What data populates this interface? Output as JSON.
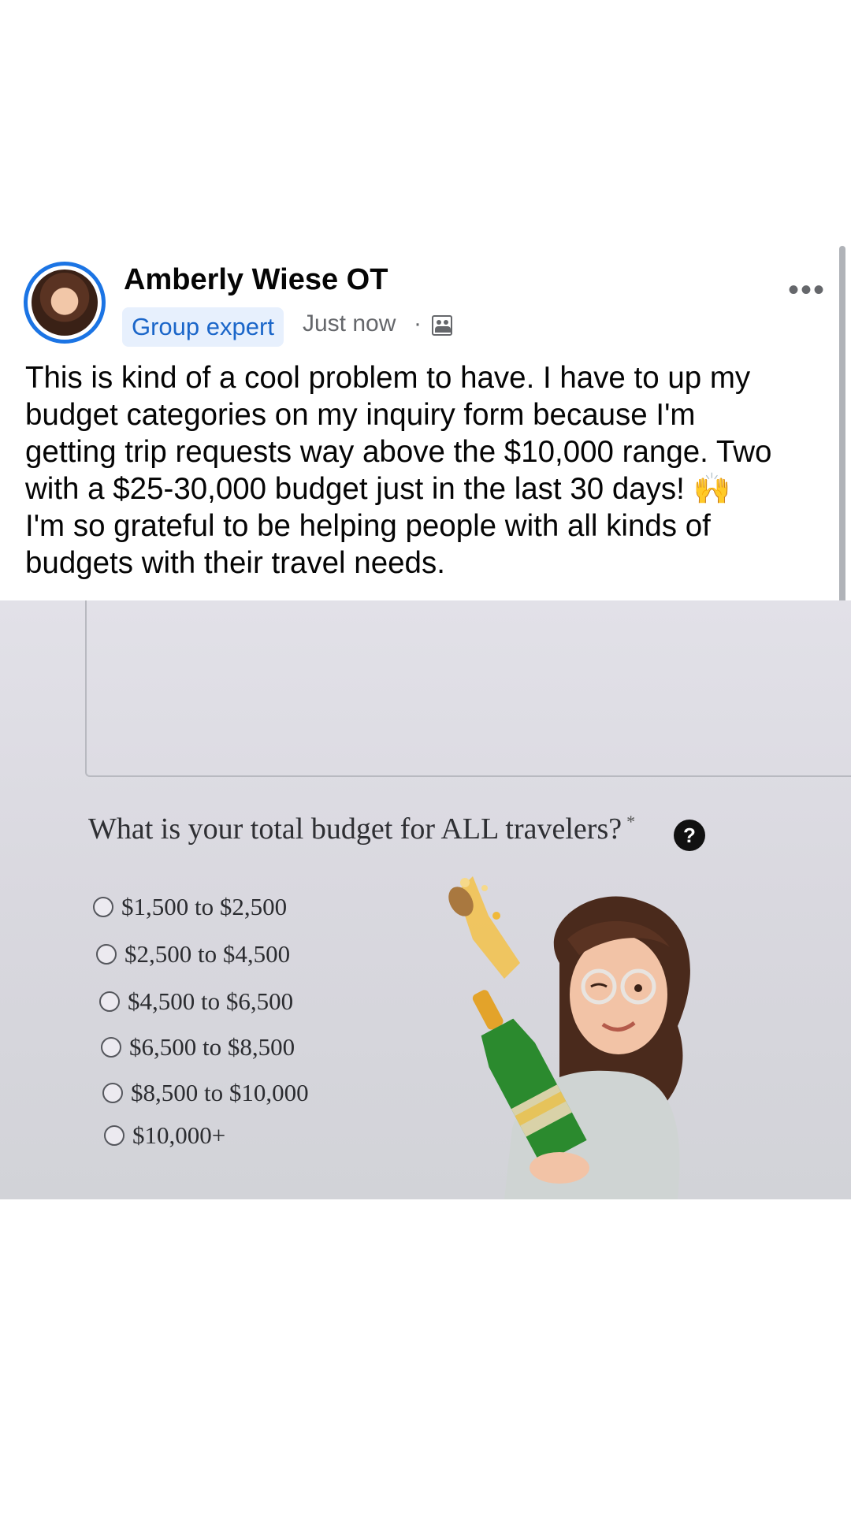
{
  "post": {
    "author": "Amberly Wiese OT",
    "badge": "Group expert",
    "timestamp": "Just now",
    "separator": "·",
    "more_icon": "more-horizontal-icon",
    "audience_icon": "group-members-icon",
    "text_lines": [
      "This is kind of a cool problem to have. I have to up my",
      "budget categories on my inquiry form because I'm",
      "getting trip requests way above the $10,000 range. Two",
      "with a $25-30,000 budget just in the last 30 days! 🙌",
      "I'm so grateful to be helping people with all kinds of",
      "budgets with their travel needs."
    ]
  },
  "photo": {
    "question": "What is your total budget for ALL travelers?",
    "required_mark": "*",
    "help_glyph": "?",
    "options": [
      "$1,500 to $2,500",
      "$2,500 to $4,500",
      "$4,500 to $6,500",
      "$6,500 to $8,500",
      "$8,500 to $10,000",
      "$10,000+"
    ],
    "sticker": "celebration-avatar-with-champagne"
  },
  "colors": {
    "accent": "#1b74e4",
    "badge_bg": "#e7f0fd",
    "badge_text": "#1b66c9",
    "secondary_text": "#65676b"
  }
}
